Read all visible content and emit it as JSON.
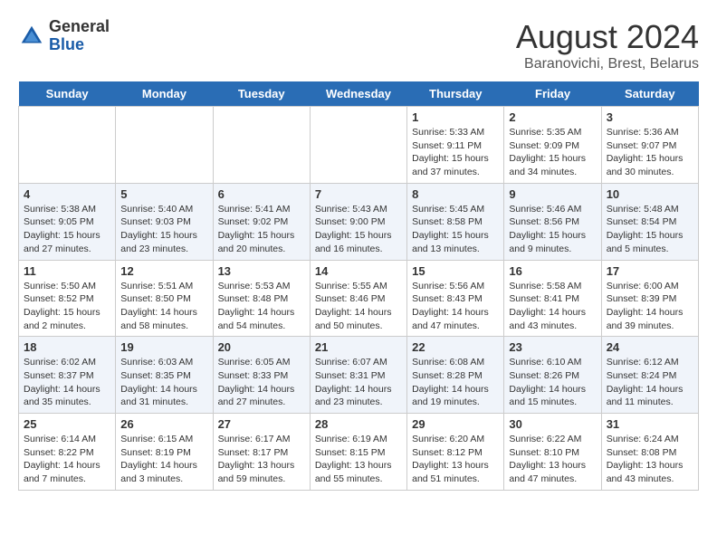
{
  "header": {
    "logo_general": "General",
    "logo_blue": "Blue",
    "month_title": "August 2024",
    "subtitle": "Baranovichi, Brest, Belarus"
  },
  "days_of_week": [
    "Sunday",
    "Monday",
    "Tuesday",
    "Wednesday",
    "Thursday",
    "Friday",
    "Saturday"
  ],
  "weeks": [
    [
      {
        "day": "",
        "info": ""
      },
      {
        "day": "",
        "info": ""
      },
      {
        "day": "",
        "info": ""
      },
      {
        "day": "",
        "info": ""
      },
      {
        "day": "1",
        "info": "Sunrise: 5:33 AM\nSunset: 9:11 PM\nDaylight: 15 hours\nand 37 minutes."
      },
      {
        "day": "2",
        "info": "Sunrise: 5:35 AM\nSunset: 9:09 PM\nDaylight: 15 hours\nand 34 minutes."
      },
      {
        "day": "3",
        "info": "Sunrise: 5:36 AM\nSunset: 9:07 PM\nDaylight: 15 hours\nand 30 minutes."
      }
    ],
    [
      {
        "day": "4",
        "info": "Sunrise: 5:38 AM\nSunset: 9:05 PM\nDaylight: 15 hours\nand 27 minutes."
      },
      {
        "day": "5",
        "info": "Sunrise: 5:40 AM\nSunset: 9:03 PM\nDaylight: 15 hours\nand 23 minutes."
      },
      {
        "day": "6",
        "info": "Sunrise: 5:41 AM\nSunset: 9:02 PM\nDaylight: 15 hours\nand 20 minutes."
      },
      {
        "day": "7",
        "info": "Sunrise: 5:43 AM\nSunset: 9:00 PM\nDaylight: 15 hours\nand 16 minutes."
      },
      {
        "day": "8",
        "info": "Sunrise: 5:45 AM\nSunset: 8:58 PM\nDaylight: 15 hours\nand 13 minutes."
      },
      {
        "day": "9",
        "info": "Sunrise: 5:46 AM\nSunset: 8:56 PM\nDaylight: 15 hours\nand 9 minutes."
      },
      {
        "day": "10",
        "info": "Sunrise: 5:48 AM\nSunset: 8:54 PM\nDaylight: 15 hours\nand 5 minutes."
      }
    ],
    [
      {
        "day": "11",
        "info": "Sunrise: 5:50 AM\nSunset: 8:52 PM\nDaylight: 15 hours\nand 2 minutes."
      },
      {
        "day": "12",
        "info": "Sunrise: 5:51 AM\nSunset: 8:50 PM\nDaylight: 14 hours\nand 58 minutes."
      },
      {
        "day": "13",
        "info": "Sunrise: 5:53 AM\nSunset: 8:48 PM\nDaylight: 14 hours\nand 54 minutes."
      },
      {
        "day": "14",
        "info": "Sunrise: 5:55 AM\nSunset: 8:46 PM\nDaylight: 14 hours\nand 50 minutes."
      },
      {
        "day": "15",
        "info": "Sunrise: 5:56 AM\nSunset: 8:43 PM\nDaylight: 14 hours\nand 47 minutes."
      },
      {
        "day": "16",
        "info": "Sunrise: 5:58 AM\nSunset: 8:41 PM\nDaylight: 14 hours\nand 43 minutes."
      },
      {
        "day": "17",
        "info": "Sunrise: 6:00 AM\nSunset: 8:39 PM\nDaylight: 14 hours\nand 39 minutes."
      }
    ],
    [
      {
        "day": "18",
        "info": "Sunrise: 6:02 AM\nSunset: 8:37 PM\nDaylight: 14 hours\nand 35 minutes."
      },
      {
        "day": "19",
        "info": "Sunrise: 6:03 AM\nSunset: 8:35 PM\nDaylight: 14 hours\nand 31 minutes."
      },
      {
        "day": "20",
        "info": "Sunrise: 6:05 AM\nSunset: 8:33 PM\nDaylight: 14 hours\nand 27 minutes."
      },
      {
        "day": "21",
        "info": "Sunrise: 6:07 AM\nSunset: 8:31 PM\nDaylight: 14 hours\nand 23 minutes."
      },
      {
        "day": "22",
        "info": "Sunrise: 6:08 AM\nSunset: 8:28 PM\nDaylight: 14 hours\nand 19 minutes."
      },
      {
        "day": "23",
        "info": "Sunrise: 6:10 AM\nSunset: 8:26 PM\nDaylight: 14 hours\nand 15 minutes."
      },
      {
        "day": "24",
        "info": "Sunrise: 6:12 AM\nSunset: 8:24 PM\nDaylight: 14 hours\nand 11 minutes."
      }
    ],
    [
      {
        "day": "25",
        "info": "Sunrise: 6:14 AM\nSunset: 8:22 PM\nDaylight: 14 hours\nand 7 minutes."
      },
      {
        "day": "26",
        "info": "Sunrise: 6:15 AM\nSunset: 8:19 PM\nDaylight: 14 hours\nand 3 minutes."
      },
      {
        "day": "27",
        "info": "Sunrise: 6:17 AM\nSunset: 8:17 PM\nDaylight: 13 hours\nand 59 minutes."
      },
      {
        "day": "28",
        "info": "Sunrise: 6:19 AM\nSunset: 8:15 PM\nDaylight: 13 hours\nand 55 minutes."
      },
      {
        "day": "29",
        "info": "Sunrise: 6:20 AM\nSunset: 8:12 PM\nDaylight: 13 hours\nand 51 minutes."
      },
      {
        "day": "30",
        "info": "Sunrise: 6:22 AM\nSunset: 8:10 PM\nDaylight: 13 hours\nand 47 minutes."
      },
      {
        "day": "31",
        "info": "Sunrise: 6:24 AM\nSunset: 8:08 PM\nDaylight: 13 hours\nand 43 minutes."
      }
    ]
  ]
}
